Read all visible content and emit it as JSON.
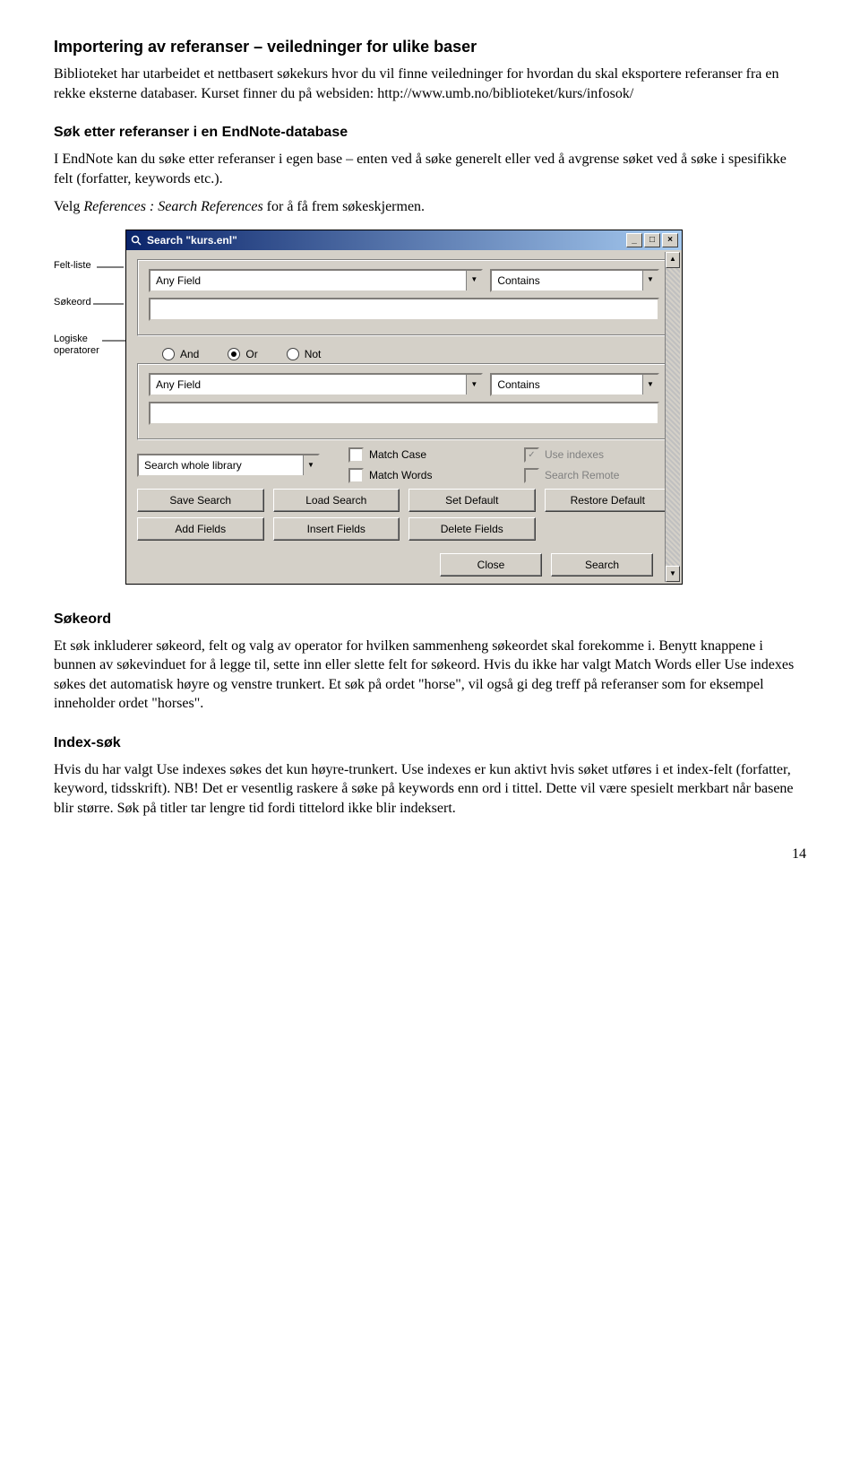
{
  "title1": "Importering av referanser – veiledninger for ulike baser",
  "para1": "Biblioteket har utarbeidet et nettbasert søkekurs hvor du vil finne veiledninger for hvordan du skal eksportere referanser fra en rekke eksterne databaser. Kurset finner du på websiden: http://www.umb.no/biblioteket/kurs/infosok/",
  "title2": "Søk etter referanser i en EndNote-database",
  "para2": "I EndNote kan du søke etter referanser i egen base – enten ved å søke generelt eller ved å avgrense søket ved å søke i spesifikke felt (forfatter, keywords etc.).",
  "para3_a": "Velg ",
  "para3_em": "References : Search References",
  "para3_b": " for å få frem søkeskjermen.",
  "side": {
    "feltliste": "Felt-liste",
    "sokeord": "Søkeord",
    "logiske": "Logiske operatorer"
  },
  "win": {
    "title": "Search \"kurs.enl\"",
    "combo_anyfield": "Any Field",
    "combo_contains": "Contains",
    "radio_and": "And",
    "radio_or": "Or",
    "radio_not": "Not",
    "scope": "Search whole library",
    "matchcase": "Match Case",
    "matchwords": "Match Words",
    "useindexes": "Use indexes",
    "searchremote": "Search Remote",
    "save": "Save Search",
    "load": "Load Search",
    "setdef": "Set Default",
    "restore": "Restore Default",
    "addf": "Add Fields",
    "insf": "Insert Fields",
    "delf": "Delete Fields",
    "close": "Close",
    "search": "Search"
  },
  "h_sokeord": "Søkeord",
  "p_sokeord": "Et søk inkluderer søkeord, felt og valg av operator for hvilken sammenheng søkeordet skal forekomme i. Benytt knappene i bunnen av søkevinduet for å legge til, sette inn eller slette felt for søkeord. Hvis du ikke har valgt Match Words eller Use indexes søkes det automatisk høyre og venstre trunkert. Et søk på ordet \"horse\", vil også gi deg treff på referanser som for eksempel inneholder ordet \"horses\".",
  "h_index": "Index-søk",
  "p_index": "Hvis du har valgt Use indexes søkes det kun høyre-trunkert. Use indexes er kun aktivt hvis søket utføres i et index-felt (forfatter, keyword, tidsskrift). NB! Det er vesentlig raskere å søke på keywords enn ord i tittel. Dette vil være spesielt merkbart når basene blir større. Søk på titler tar lengre tid fordi tittelord ikke blir indeksert.",
  "pagenum": "14"
}
